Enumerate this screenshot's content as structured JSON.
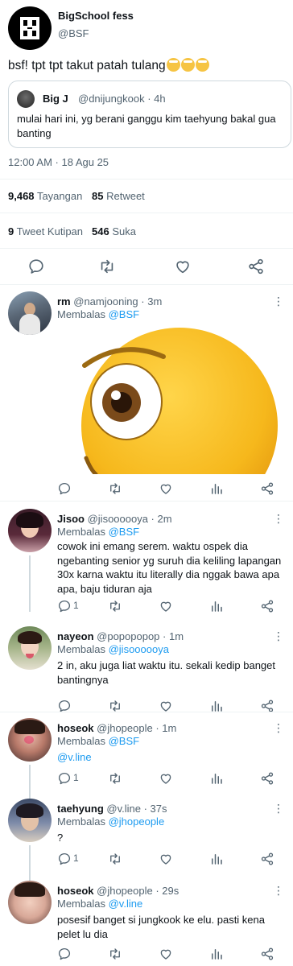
{
  "main_tweet": {
    "name": "BigSchool fess",
    "handle": "@BSF",
    "text": "bsf! tpt tpt takut patah tulang",
    "quote": {
      "name": "Big J",
      "handle": "@dnijungkook · 4h",
      "text": "mulai hari ini, yg berani ganggu kim taehyung bakal gua banting"
    },
    "timestamp": "12:00 AM · 18 Agu 25",
    "views_count": "9,468",
    "views_label": "Tayangan",
    "retweets_count": "85",
    "retweets_label": "Retweet",
    "quotes_count": "9",
    "quotes_label": "Tweet Kutipan",
    "likes_count": "546",
    "likes_label": "Suka"
  },
  "replies": [
    {
      "name": "rm",
      "meta": "@namjooning · 3m",
      "replying_label": "Membalas",
      "replying_to": "@BSF",
      "text": "",
      "reply_count": ""
    },
    {
      "name": "Jisoo",
      "meta": "@jisoooooya · 2m",
      "replying_label": "Membalas",
      "replying_to": "@BSF",
      "text": "cowok ini emang serem. waktu ospek dia ngebanting senior yg suruh dia keliling lapangan 30x karna waktu itu literally dia nggak bawa apa apa, baju tiduran aja",
      "reply_count": "1"
    },
    {
      "name": "nayeon",
      "meta": "@popopopop · 1m",
      "replying_label": "Membalas",
      "replying_to": "@jisoooooya",
      "text": "2 in, aku juga liat waktu itu. sekali kedip banget bantingnya",
      "reply_count": ""
    },
    {
      "name": "hoseok",
      "meta": "@jhopeople · 1m",
      "replying_label": "Membalas",
      "replying_to": "@BSF",
      "text": "@v.line",
      "reply_count": "1"
    },
    {
      "name": "taehyung",
      "meta": "@v.line · 37s",
      "replying_label": "Membalas",
      "replying_to": "@jhopeople",
      "text": "?",
      "reply_count": "1"
    },
    {
      "name": "hoseok",
      "meta": "@jhopeople · 29s",
      "replying_label": "Membalas",
      "replying_to": "@v.line",
      "text": "posesif banget si jungkook ke elu. pasti kena pelet lu dia",
      "reply_count": ""
    }
  ],
  "colors": {
    "link": "#1d9bf0",
    "secondary_text": "#536471",
    "divider": "#eff3f4",
    "emoji_yellow": "#f6c443"
  },
  "icons": [
    "more-icon",
    "reply-icon",
    "retweet-icon",
    "like-icon",
    "views-icon",
    "share-icon"
  ]
}
